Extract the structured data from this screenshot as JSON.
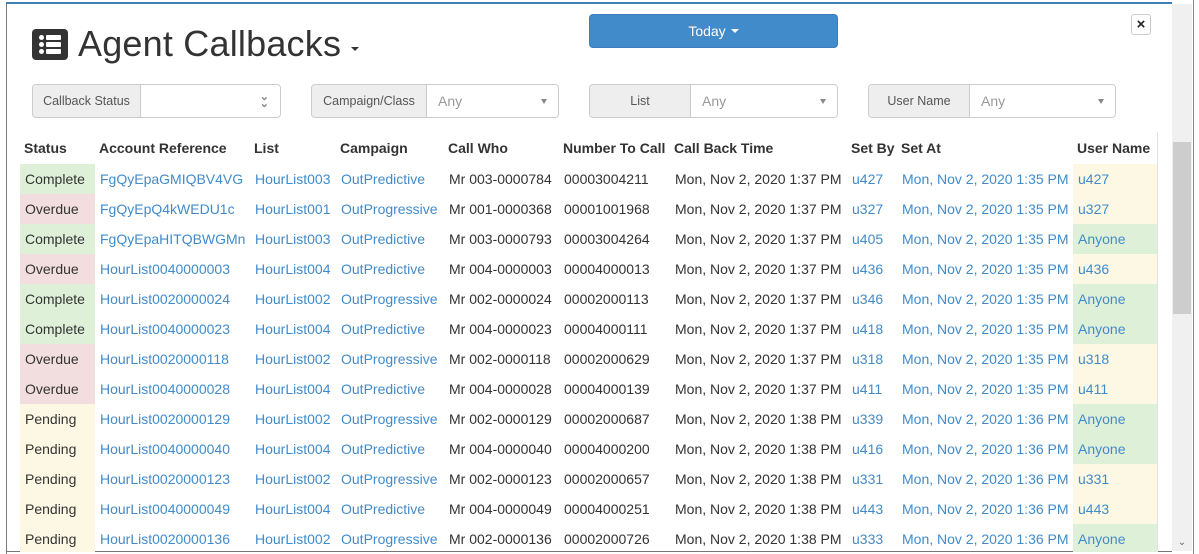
{
  "header": {
    "title": "Agent Callbacks",
    "title_icon": "list-icon",
    "date_range_button": "Today",
    "close_label": "×"
  },
  "filters": [
    {
      "label": "Callback Status",
      "value": "",
      "placeholder": "",
      "type": "multiselect"
    },
    {
      "label": "Campaign/Class",
      "value": "Any",
      "type": "select"
    },
    {
      "label": "List",
      "value": "Any",
      "type": "select"
    },
    {
      "label": "User Name",
      "value": "Any",
      "type": "select"
    }
  ],
  "table": {
    "columns": [
      "Status",
      "Account Reference",
      "List",
      "Campaign",
      "Call Who",
      "Number To Call",
      "Call Back Time",
      "Set By",
      "Set At",
      "User Name"
    ],
    "rows": [
      {
        "status": "Complete",
        "account_ref": "FgQyEpaGMIQBV4VG",
        "list": "HourList003",
        "campaign": "OutPredictive",
        "call_who": "Mr 003-0000784",
        "number": "00003004211",
        "callback_time": "Mon, Nov 2, 2020 1:37 PM",
        "set_by": "u427",
        "set_at": "Mon, Nov 2, 2020 1:35 PM",
        "user_name": "u427"
      },
      {
        "status": "Overdue",
        "account_ref": "FgQyEpQ4kWEDU1c",
        "list": "HourList001",
        "campaign": "OutProgressive",
        "call_who": "Mr 001-0000368",
        "number": "00001001968",
        "callback_time": "Mon, Nov 2, 2020 1:37 PM",
        "set_by": "u327",
        "set_at": "Mon, Nov 2, 2020 1:35 PM",
        "user_name": "u327"
      },
      {
        "status": "Complete",
        "account_ref": "FgQyEpaHITQBWGMn",
        "list": "HourList003",
        "campaign": "OutPredictive",
        "call_who": "Mr 003-0000793",
        "number": "00003004264",
        "callback_time": "Mon, Nov 2, 2020 1:37 PM",
        "set_by": "u405",
        "set_at": "Mon, Nov 2, 2020 1:35 PM",
        "user_name": "Anyone"
      },
      {
        "status": "Overdue",
        "account_ref": "HourList0040000003",
        "list": "HourList004",
        "campaign": "OutPredictive",
        "call_who": "Mr 004-0000003",
        "number": "00004000013",
        "callback_time": "Mon, Nov 2, 2020 1:37 PM",
        "set_by": "u436",
        "set_at": "Mon, Nov 2, 2020 1:35 PM",
        "user_name": "u436"
      },
      {
        "status": "Complete",
        "account_ref": "HourList0020000024",
        "list": "HourList002",
        "campaign": "OutProgressive",
        "call_who": "Mr 002-0000024",
        "number": "00002000113",
        "callback_time": "Mon, Nov 2, 2020 1:37 PM",
        "set_by": "u346",
        "set_at": "Mon, Nov 2, 2020 1:35 PM",
        "user_name": "Anyone"
      },
      {
        "status": "Complete",
        "account_ref": "HourList0040000023",
        "list": "HourList004",
        "campaign": "OutPredictive",
        "call_who": "Mr 004-0000023",
        "number": "00004000111",
        "callback_time": "Mon, Nov 2, 2020 1:37 PM",
        "set_by": "u418",
        "set_at": "Mon, Nov 2, 2020 1:35 PM",
        "user_name": "Anyone"
      },
      {
        "status": "Overdue",
        "account_ref": "HourList0020000118",
        "list": "HourList002",
        "campaign": "OutProgressive",
        "call_who": "Mr 002-0000118",
        "number": "00002000629",
        "callback_time": "Mon, Nov 2, 2020 1:37 PM",
        "set_by": "u318",
        "set_at": "Mon, Nov 2, 2020 1:35 PM",
        "user_name": "u318"
      },
      {
        "status": "Overdue",
        "account_ref": "HourList0040000028",
        "list": "HourList004",
        "campaign": "OutPredictive",
        "call_who": "Mr 004-0000028",
        "number": "00004000139",
        "callback_time": "Mon, Nov 2, 2020 1:37 PM",
        "set_by": "u411",
        "set_at": "Mon, Nov 2, 2020 1:35 PM",
        "user_name": "u411"
      },
      {
        "status": "Pending",
        "account_ref": "HourList0020000129",
        "list": "HourList002",
        "campaign": "OutProgressive",
        "call_who": "Mr 002-0000129",
        "number": "00002000687",
        "callback_time": "Mon, Nov 2, 2020 1:38 PM",
        "set_by": "u339",
        "set_at": "Mon, Nov 2, 2020 1:36 PM",
        "user_name": "Anyone"
      },
      {
        "status": "Pending",
        "account_ref": "HourList0040000040",
        "list": "HourList004",
        "campaign": "OutPredictive",
        "call_who": "Mr 004-0000040",
        "number": "00004000200",
        "callback_time": "Mon, Nov 2, 2020 1:38 PM",
        "set_by": "u416",
        "set_at": "Mon, Nov 2, 2020 1:36 PM",
        "user_name": "Anyone"
      },
      {
        "status": "Pending",
        "account_ref": "HourList0020000123",
        "list": "HourList002",
        "campaign": "OutProgressive",
        "call_who": "Mr 002-0000123",
        "number": "00002000657",
        "callback_time": "Mon, Nov 2, 2020 1:38 PM",
        "set_by": "u331",
        "set_at": "Mon, Nov 2, 2020 1:36 PM",
        "user_name": "u331"
      },
      {
        "status": "Pending",
        "account_ref": "HourList0040000049",
        "list": "HourList004",
        "campaign": "OutPredictive",
        "call_who": "Mr 004-0000049",
        "number": "00004000251",
        "callback_time": "Mon, Nov 2, 2020 1:38 PM",
        "set_by": "u443",
        "set_at": "Mon, Nov 2, 2020 1:36 PM",
        "user_name": "u443"
      },
      {
        "status": "Pending",
        "account_ref": "HourList0020000136",
        "list": "HourList002",
        "campaign": "OutProgressive",
        "call_who": "Mr 002-0000136",
        "number": "00002000726",
        "callback_time": "Mon, Nov 2, 2020 1:38 PM",
        "set_by": "u333",
        "set_at": "Mon, Nov 2, 2020 1:36 PM",
        "user_name": "Anyone"
      }
    ]
  },
  "colors": {
    "primary": "#428bca",
    "status_complete": "#dff0d8",
    "status_overdue": "#f2dede",
    "status_pending": "#fcf8e3"
  }
}
